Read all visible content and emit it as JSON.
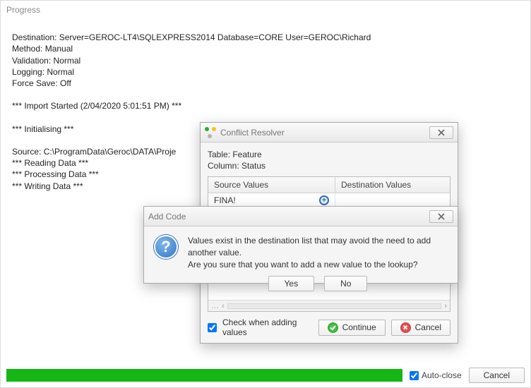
{
  "header": {
    "title": "Progress"
  },
  "log": {
    "destination": "Destination: Server=GEROC-LT4\\SQLEXPRESS2014 Database=CORE User=GEROC\\Richard",
    "method": "Method: Manual",
    "validation": "Validation: Normal",
    "logging": "Logging: Normal",
    "force_save": "Force Save: Off",
    "import_started": "*** Import Started (2/04/2020 5:01:51 PM) ***",
    "initialising": "*** Initialising ***",
    "source": "Source: C:\\ProgramData\\Geroc\\DATA\\Proje",
    "reading": "*** Reading Data ***",
    "processing": "*** Processing Data ***",
    "writing": "*** Writing Data ***"
  },
  "footer": {
    "autoclose_label": "Auto-close",
    "cancel_label": "Cancel"
  },
  "conflict": {
    "title": "Conflict Resolver",
    "table_label": "Table: Feature",
    "column_label": "Column: Status",
    "col_source": "Source Values",
    "col_dest": "Destination Values",
    "rows": [
      {
        "source": "FINA!",
        "dest": ""
      }
    ],
    "check_label": "Check when adding values",
    "continue_label": "Continue",
    "cancel_label": "Cancel"
  },
  "msg": {
    "title": "Add Code",
    "line1": "Values exist in the destination list that may avoid the need to add another value.",
    "line2": "Are you sure that you want to add a new value to the lookup?",
    "yes": "Yes",
    "no": "No"
  }
}
